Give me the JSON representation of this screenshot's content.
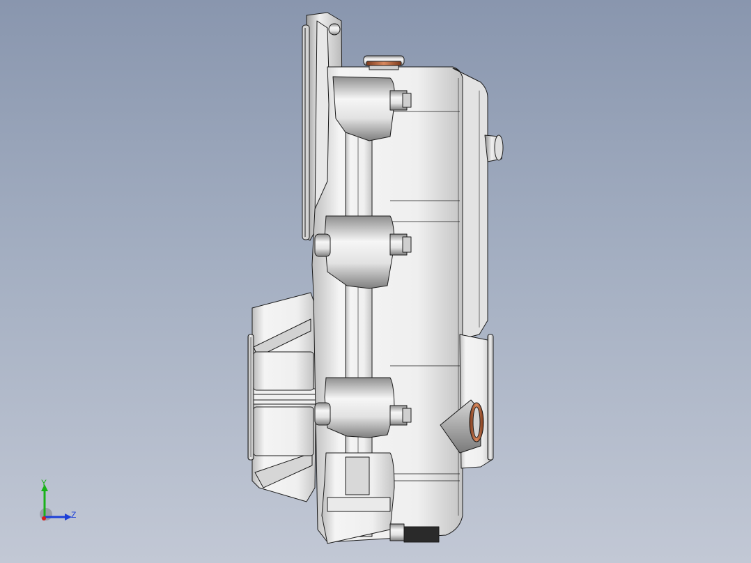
{
  "viewport": {
    "background_top": "#8996ae",
    "background_bottom": "#c2c8d5",
    "model_name": "gearbox-housing",
    "view": "side"
  },
  "triad": {
    "y_label": "Y",
    "z_label": "Z",
    "y_color": "#19b219",
    "z_color": "#1c3fd8",
    "x_color": "#d81c1c"
  },
  "colors": {
    "body": "#ececec",
    "edge": "#1b1b1b",
    "shadow": "#9a9a9a",
    "seal": "#b5633c"
  }
}
